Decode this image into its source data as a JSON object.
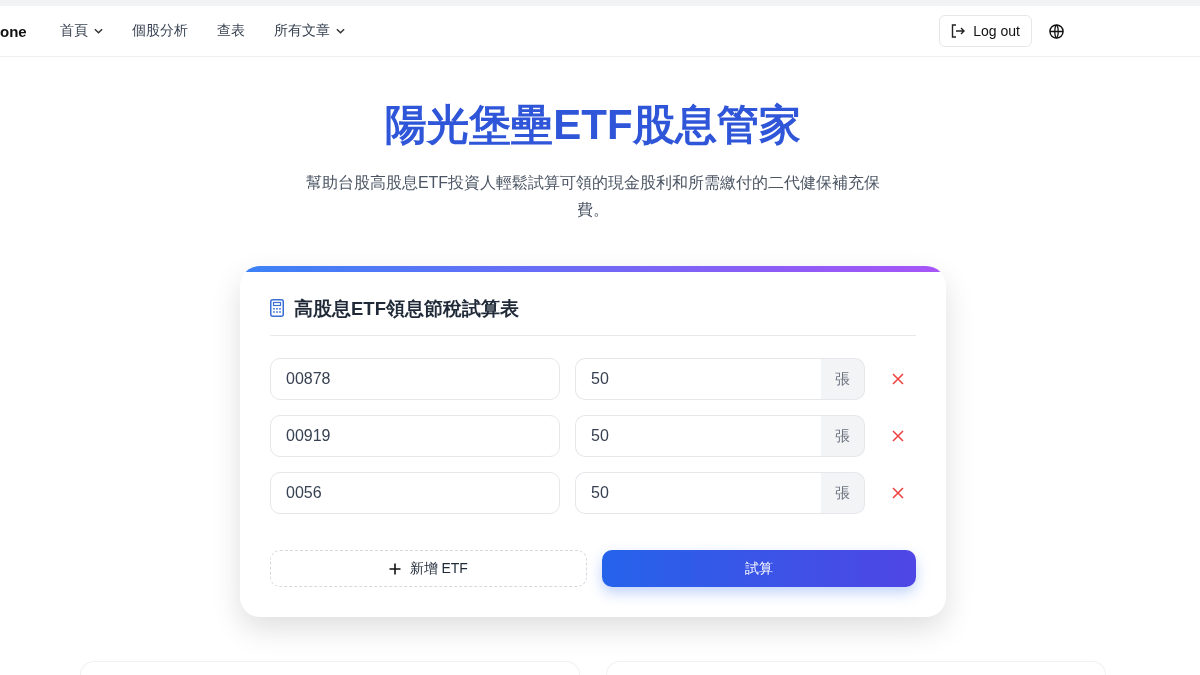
{
  "nav": {
    "brand": "one",
    "items": [
      {
        "label": "首頁",
        "dropdown": true
      },
      {
        "label": "個股分析",
        "dropdown": false
      },
      {
        "label": "查表",
        "dropdown": false
      },
      {
        "label": "所有文章",
        "dropdown": true
      }
    ],
    "logout": "Log out"
  },
  "hero": {
    "title": "陽光堡壘ETF股息管家",
    "subtitle": "幫助台股高股息ETF投資人輕鬆試算可領的現金股利和所需繳付的二代健保補充保費。"
  },
  "calculator": {
    "title": "高股息ETF領息節稅試算表",
    "rows": [
      {
        "code": "00878",
        "quantity": "50",
        "unit": "張"
      },
      {
        "code": "00919",
        "quantity": "50",
        "unit": "張"
      },
      {
        "code": "0056",
        "quantity": "50",
        "unit": "張"
      }
    ],
    "add_button": "新增 ETF",
    "submit_button": "試算"
  }
}
